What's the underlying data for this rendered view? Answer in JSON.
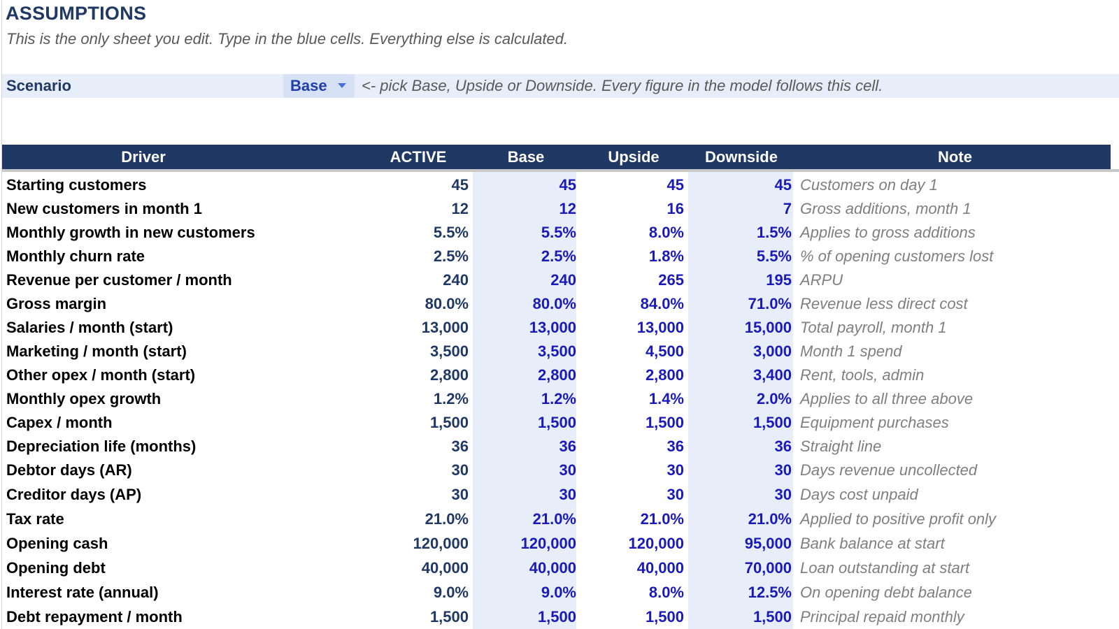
{
  "title": "ASSUMPTIONS",
  "subtitle": "This is the only sheet you edit. Type in the blue cells. Everything else is calculated.",
  "scenario": {
    "label": "Scenario",
    "selected": "Base",
    "hint": "<- pick Base, Upside or Downside. Every figure in the model follows this cell."
  },
  "columns": {
    "driver": "Driver",
    "active": "ACTIVE",
    "base": "Base",
    "upside": "Upside",
    "downside": "Downside",
    "note": "Note"
  },
  "colors": {
    "header_bg": "#1f3864",
    "input_blue_text": "#1a1ab8",
    "input_cell_bg": "#e8eef9",
    "note_gray": "#7f7f7f"
  },
  "icons": {
    "dropdown": "chevron-down-icon"
  },
  "rows": [
    {
      "driver": "Starting customers",
      "active": "45",
      "base": "45",
      "upside": "45",
      "downside": "45",
      "note": "Customers on day 1"
    },
    {
      "driver": "New customers in month 1",
      "active": "12",
      "base": "12",
      "upside": "16",
      "downside": "7",
      "note": "Gross additions, month 1"
    },
    {
      "driver": "Monthly growth in new customers",
      "active": "5.5%",
      "base": "5.5%",
      "upside": "8.0%",
      "downside": "1.5%",
      "note": "Applies to gross additions"
    },
    {
      "driver": "Monthly churn rate",
      "active": "2.5%",
      "base": "2.5%",
      "upside": "1.8%",
      "downside": "5.5%",
      "note": "% of opening customers lost"
    },
    {
      "driver": "Revenue per customer / month",
      "active": "240",
      "base": "240",
      "upside": "265",
      "downside": "195",
      "note": "ARPU"
    },
    {
      "driver": "Gross margin",
      "active": "80.0%",
      "base": "80.0%",
      "upside": "84.0%",
      "downside": "71.0%",
      "note": "Revenue less direct cost"
    },
    {
      "driver": "Salaries / month (start)",
      "active": "13,000",
      "base": "13,000",
      "upside": "13,000",
      "downside": "15,000",
      "note": "Total payroll, month 1"
    },
    {
      "driver": "Marketing / month (start)",
      "active": "3,500",
      "base": "3,500",
      "upside": "4,500",
      "downside": "3,000",
      "note": "Month 1 spend"
    },
    {
      "driver": "Other opex / month (start)",
      "active": "2,800",
      "base": "2,800",
      "upside": "2,800",
      "downside": "3,400",
      "note": "Rent, tools, admin"
    },
    {
      "driver": "Monthly opex growth",
      "active": "1.2%",
      "base": "1.2%",
      "upside": "1.4%",
      "downside": "2.0%",
      "note": "Applies to all three above"
    },
    {
      "driver": "Capex / month",
      "active": "1,500",
      "base": "1,500",
      "upside": "1,500",
      "downside": "1,500",
      "note": "Equipment purchases"
    },
    {
      "driver": "Depreciation life (months)",
      "active": "36",
      "base": "36",
      "upside": "36",
      "downside": "36",
      "note": "Straight line"
    },
    {
      "driver": "Debtor days (AR)",
      "active": "30",
      "base": "30",
      "upside": "30",
      "downside": "30",
      "note": "Days revenue uncollected"
    },
    {
      "driver": "Creditor days (AP)",
      "active": "30",
      "base": "30",
      "upside": "30",
      "downside": "30",
      "note": "Days cost unpaid"
    },
    {
      "driver": "Tax rate",
      "active": "21.0%",
      "base": "21.0%",
      "upside": "21.0%",
      "downside": "21.0%",
      "note": "Applied to positive profit only"
    },
    {
      "driver": "Opening cash",
      "active": "120,000",
      "base": "120,000",
      "upside": "120,000",
      "downside": "95,000",
      "note": "Bank balance at start"
    },
    {
      "driver": "Opening debt",
      "active": "40,000",
      "base": "40,000",
      "upside": "40,000",
      "downside": "70,000",
      "note": "Loan outstanding at start"
    },
    {
      "driver": "Interest rate (annual)",
      "active": "9.0%",
      "base": "9.0%",
      "upside": "8.0%",
      "downside": "12.5%",
      "note": "On opening debt balance"
    },
    {
      "driver": "Debt repayment / month",
      "active": "1,500",
      "base": "1,500",
      "upside": "1,500",
      "downside": "1,500",
      "note": "Principal repaid monthly"
    }
  ]
}
